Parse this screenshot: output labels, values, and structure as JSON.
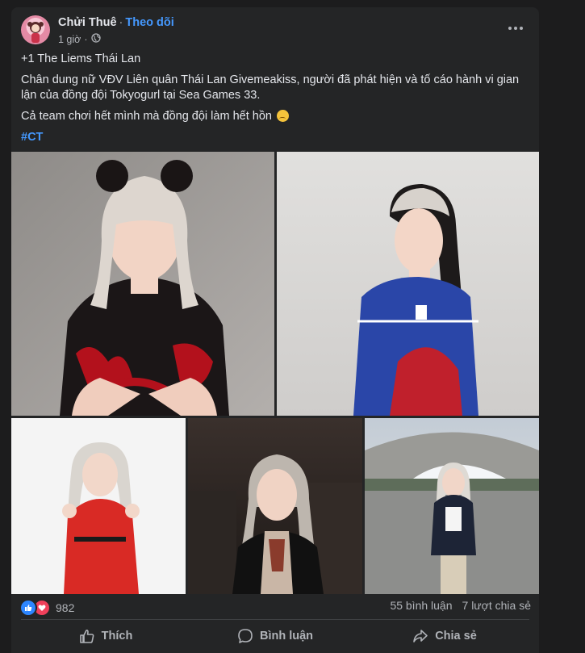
{
  "post": {
    "author": "Chửi Thuê",
    "separator": "·",
    "follow_label": "Theo dõi",
    "time": "1 giờ",
    "privacy_icon": "globe-icon",
    "more_icon": "more-horizontal-icon",
    "text_line1": "+1 The Liems Thái Lan",
    "text_line2": "Chân dung nữ VĐV Liên quân Thái Lan Givemeakiss, người đã phát hiện và tố cáo hành vi gian lận của đồng đội Tokyogurl tại Sea Games 33.",
    "text_line3": "Cả team chơi hết mình mà đồng đội làm hết hồn",
    "emoji": "sad-face-emoji",
    "hashtag": "#CT"
  },
  "photos": [
    {
      "name": "photo-red-black-jersey"
    },
    {
      "name": "photo-blue-jersey"
    },
    {
      "name": "photo-red-jersey-pose"
    },
    {
      "name": "photo-black-top-scarf"
    },
    {
      "name": "photo-stadium-blazer"
    }
  ],
  "stats": {
    "reaction_count": "982",
    "reaction_icons": [
      "like-icon",
      "love-icon"
    ],
    "comments": "55 bình luận",
    "shares": "7 lượt chia sẻ"
  },
  "actions": {
    "like": "Thích",
    "comment": "Bình luận",
    "share": "Chia sẻ"
  },
  "colors": {
    "background": "#1c1c1d",
    "card": "#242526",
    "link": "#4599ff",
    "secondary_text": "#b0b3b8"
  }
}
